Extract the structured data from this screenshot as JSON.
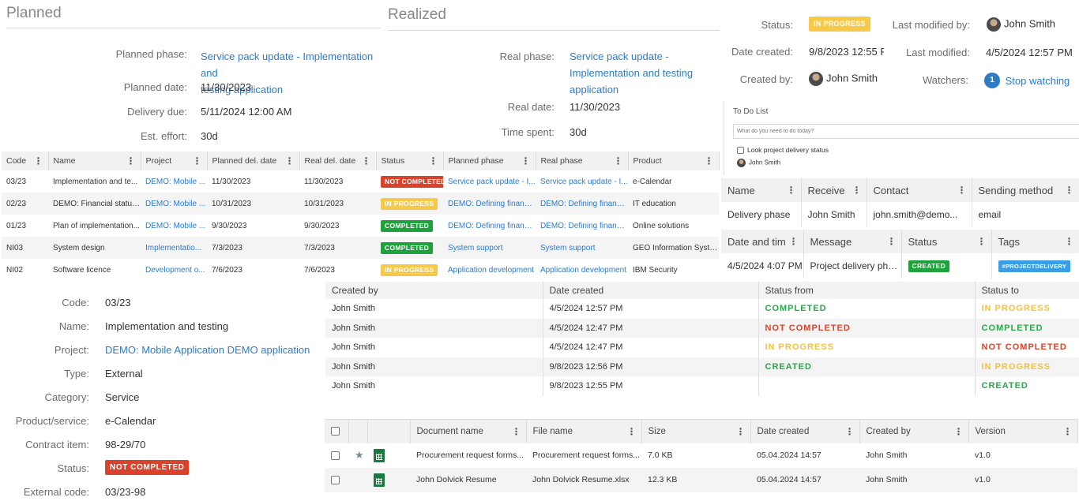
{
  "planned": {
    "title": "Planned",
    "phase_label": "Planned phase:",
    "phase_line1": "Service pack update - Implementation and",
    "phase_line2": "testing application",
    "date_label": "Planned date:",
    "date": "11/30/2023",
    "delivery_label": "Delivery due:",
    "delivery": "5/11/2024 12:00 AM",
    "effort_label": "Est. effort:",
    "effort": "30d"
  },
  "realized": {
    "title": "Realized",
    "phase_label": "Real phase:",
    "phase_line1": "Service pack update -",
    "phase_line2": "Implementation and testing",
    "phase_line3": "application",
    "date_label": "Real date:",
    "date": "11/30/2023",
    "spent_label": "Time spent:",
    "spent": "30d"
  },
  "meta": {
    "status_label": "Status:",
    "status": "IN PROGRESS",
    "modified_by_label": "Last modified by:",
    "modified_by": "John Smith",
    "created_label": "Date created:",
    "created": "9/8/2023 12:55 F",
    "modified_label": "Last modified:",
    "modified": "4/5/2024 12:57 PM",
    "created_by_label": "Created by:",
    "created_by": "John Smith",
    "watchers_label": "Watchers:",
    "watchers_count": "1",
    "stop_watching": "Stop watching"
  },
  "todo": {
    "title": "To Do List",
    "placeholder": "What do you need to do today?",
    "item": "Look project delivery status",
    "user": "John Smith"
  },
  "delivery_grid": {
    "headers": [
      "Code",
      "Name",
      "Project",
      "Planned del. date",
      "Real del. date",
      "Status",
      "Planned phase",
      "Real phase",
      "Product"
    ],
    "rows": [
      {
        "code": "03/23",
        "name": "Implementation and te...",
        "project": "DEMO: Mobile ...",
        "planned": "11/30/2023",
        "real": "11/30/2023",
        "status": "NOT COMPLETED",
        "pphase": "Service pack update - I...",
        "rphase": "Service pack update - I...",
        "product": "e-Calendar"
      },
      {
        "code": "02/23",
        "name": "DEMO: Financial status ...",
        "project": "DEMO: Mobile ...",
        "planned": "10/31/2023",
        "real": "10/31/2023",
        "status": "IN PROGRESS",
        "pphase": "DEMO: Defining financi...",
        "rphase": "DEMO: Defining financi...",
        "product": "IT education"
      },
      {
        "code": "01/23",
        "name": "Plan of implementation...",
        "project": "DEMO: Mobile ...",
        "planned": "9/30/2023",
        "real": "9/30/2023",
        "status": "COMPLETED",
        "pphase": "DEMO: Defining financi...",
        "rphase": "DEMO: Defining financi...",
        "product": "Online solutions"
      },
      {
        "code": "NI03",
        "name": "System design",
        "project": "Implementatio...",
        "planned": "7/3/2023",
        "real": "7/3/2023",
        "status": "COMPLETED",
        "pphase": "System support",
        "rphase": "System support",
        "product": "GEO Information Syste..."
      },
      {
        "code": "NI02",
        "name": "Software licence",
        "project": "Development o...",
        "planned": "7/6/2023",
        "real": "7/6/2023",
        "status": "IN PROGRESS",
        "pphase": "Application development",
        "rphase": "Application development",
        "product": "IBM Security"
      }
    ]
  },
  "notify_grid": {
    "headers": [
      "Name",
      "Receive",
      "Contact",
      "Sending method"
    ],
    "row": {
      "name": "Delivery phase",
      "receive": "John Smith",
      "contact": "john.smith@demo...",
      "method": "email"
    }
  },
  "message_grid": {
    "headers": [
      "Date and tim",
      "Message",
      "Status",
      "Tags"
    ],
    "row": {
      "date": "4/5/2024 4:07 PM",
      "message": "Project delivery pha...",
      "status": "CREATED",
      "tag": "#PROJECTDELIVERY"
    }
  },
  "details": {
    "code_label": "Code:",
    "code": "03/23",
    "name_label": "Name:",
    "name": "Implementation and testing",
    "project_label": "Project:",
    "project": "DEMO: Mobile Application DEMO application",
    "type_label": "Type:",
    "type": "External",
    "category_label": "Category:",
    "category": "Service",
    "product_label": "Product/service:",
    "product": "e-Calendar",
    "contract_label": "Contract item:",
    "contract": "98-29/70",
    "status_label": "Status:",
    "status": "NOT COMPLETED",
    "external_label": "External code:",
    "external": "03/23-98"
  },
  "history": {
    "headers": [
      "Created by",
      "Date created",
      "Status from",
      "Status to"
    ],
    "rows": [
      {
        "by": "John Smith",
        "date": "4/5/2024 12:57 PM",
        "from": "COMPLETED",
        "to": "IN PROGRESS"
      },
      {
        "by": "John Smith",
        "date": "4/5/2024 12:47 PM",
        "from": "NOT COMPLETED",
        "to": "COMPLETED"
      },
      {
        "by": "John Smith",
        "date": "4/5/2024 12:47 PM",
        "from": "IN PROGRESS",
        "to": "NOT COMPLETED"
      },
      {
        "by": "John Smith",
        "date": "9/8/2023 12:56 PM",
        "from": "CREATED",
        "to": "IN PROGRESS"
      },
      {
        "by": "John Smith",
        "date": "9/8/2023 12:55 PM",
        "from": "",
        "to": "CREATED"
      }
    ]
  },
  "documents": {
    "headers": [
      "Document name",
      "File name",
      "Size",
      "Date created",
      "Created by",
      "Version"
    ],
    "rows": [
      {
        "doc": "Procurement request forms...",
        "file": "Procurement request forms...",
        "size": "7.0 KB",
        "date": "05.04.2024 14:57",
        "by": "John Smith",
        "version": "v1.0"
      },
      {
        "doc": "John Dolvick Resume",
        "file": "John Dolvick Resume.xlsx",
        "size": "12.3 KB",
        "date": "05.04.2024 14:57",
        "by": "John Smith",
        "version": "v1.0"
      }
    ]
  },
  "colors": {
    "link": "#2f7bc4",
    "not_completed": "#d9432b",
    "in_progress": "#f7c948",
    "completed": "#1ea33c",
    "tag": "#3b9ee3"
  }
}
